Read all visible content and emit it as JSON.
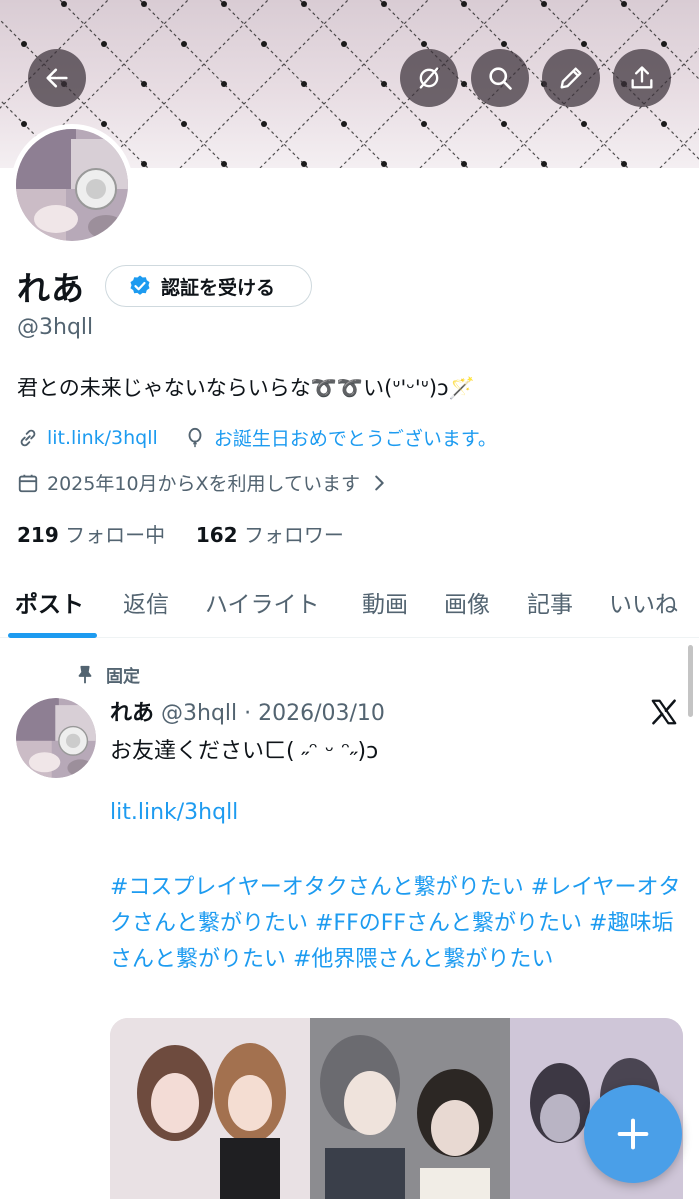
{
  "profile": {
    "name": "れあ",
    "handle": "@3hqll",
    "verify_label": "認証を受ける",
    "bio": "君との未来じゃないならいらな➰➰い(ᐡ'ᵕ'ᐡ)ɔ🪄",
    "link": "lit.link/3hqll",
    "birthday": "お誕生日おめでとうございます。",
    "joined": "2025年10月からXを利用しています",
    "following_count": "219",
    "following_label": "フォロー中",
    "followers_count": "162",
    "followers_label": "フォロワー"
  },
  "header_icons": [
    "back-arrow-icon",
    "grok-icon",
    "search-icon",
    "edit-pencil-icon",
    "share-upload-icon"
  ],
  "tabs": [
    {
      "label": "ポスト"
    },
    {
      "label": "返信"
    },
    {
      "label": "ハイライト"
    },
    {
      "label": "動画"
    },
    {
      "label": "画像"
    },
    {
      "label": "記事"
    },
    {
      "label": "いいね"
    }
  ],
  "post": {
    "pinned_label": "固定",
    "author": "れあ",
    "handle_date": "@3hqll · 2026/03/10",
    "text": "お友達くださいㄈ( ˶ᵔ ᵕ ᵔ˶)ɔ",
    "link": "lit.link/3hqll",
    "hashtags": "#コスプレイヤーオタクさんと繋がりたい  #レイヤーオタクさんと繋がりたい #FFのFFさんと繋がりたい #趣味垢さんと繋がりたい #他界隈さんと繋がりたい"
  },
  "colors": {
    "accent": "#1d9bf0",
    "fab": "#4a9fe8",
    "text_primary": "#0f1419",
    "text_secondary": "#536471"
  }
}
